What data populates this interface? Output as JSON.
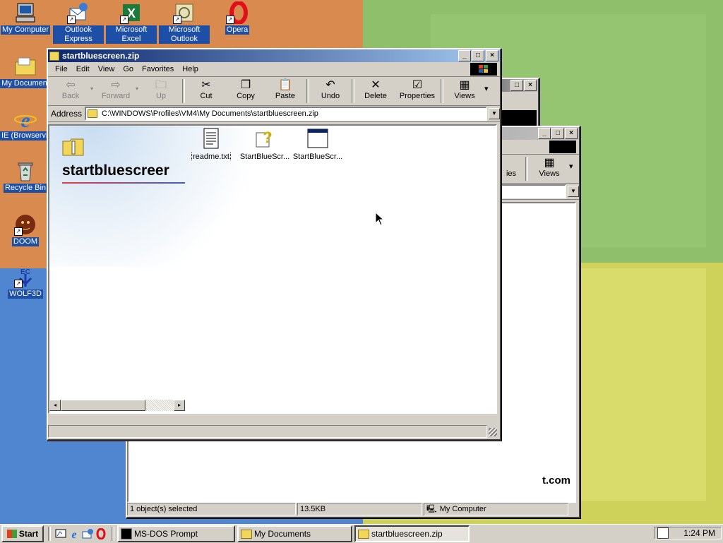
{
  "desktop": {
    "icons": [
      {
        "label": "My Computer",
        "icon": "my-computer-icon"
      },
      {
        "label": "Outlook Express",
        "icon": "outlook-express-icon"
      },
      {
        "label": "Microsoft Excel",
        "icon": "excel-icon"
      },
      {
        "label": "Microsoft Outlook",
        "icon": "outlook-icon"
      },
      {
        "label": "Opera",
        "icon": "opera-icon"
      },
      {
        "label": "My Document",
        "icon": "my-documents-icon"
      },
      {
        "label": "IE (Browservice",
        "icon": "ie-icon"
      },
      {
        "label": "Recycle Bin",
        "icon": "recycle-bin-icon"
      },
      {
        "label": "DOOM",
        "icon": "doom-icon"
      },
      {
        "label": "WOLF3D",
        "icon": "wolf3d-icon"
      }
    ],
    "partial_text": "t.com"
  },
  "front_window": {
    "title": "startbluescreen.zip",
    "menu": [
      "File",
      "Edit",
      "View",
      "Go",
      "Favorites",
      "Help"
    ],
    "toolbar": [
      {
        "label": "Back",
        "icon": "back-arrow-icon",
        "enabled": false
      },
      {
        "label": "Forward",
        "icon": "forward-arrow-icon",
        "enabled": false
      },
      {
        "label": "Up",
        "icon": "up-folder-icon",
        "enabled": false
      },
      {
        "label": "Cut",
        "icon": "scissors-icon",
        "enabled": true
      },
      {
        "label": "Copy",
        "icon": "copy-icon",
        "enabled": true
      },
      {
        "label": "Paste",
        "icon": "paste-icon",
        "enabled": true
      },
      {
        "label": "Undo",
        "icon": "undo-icon",
        "enabled": true
      },
      {
        "label": "Delete",
        "icon": "delete-x-icon",
        "enabled": true
      },
      {
        "label": "Properties",
        "icon": "properties-icon",
        "enabled": true
      },
      {
        "label": "Views",
        "icon": "views-icon",
        "enabled": true
      }
    ],
    "address_label": "Address",
    "address_value": "C:\\WINDOWS\\Profiles\\VM4\\My Documents\\startbluescreen.zip",
    "banner_title": "startbluescreer",
    "files": [
      {
        "name": "readme.txt",
        "icon": "text-file-icon",
        "selected": true
      },
      {
        "name": "StartBlueScr...",
        "icon": "help-file-icon",
        "selected": false
      },
      {
        "name": "StartBlueScr...",
        "icon": "application-icon",
        "selected": false
      }
    ]
  },
  "back_window": {
    "views_label": "Views",
    "partial_toolbar": "ies",
    "status": {
      "selection": "1 object(s) selected",
      "size": "13.5KB",
      "location": "My Computer"
    }
  },
  "taskbar": {
    "start_label": "Start",
    "tasks": [
      {
        "label": "MS-DOS Prompt",
        "icon": "msdos-icon",
        "active": false
      },
      {
        "label": "My Documents",
        "icon": "folder-icon",
        "active": false
      },
      {
        "label": "startbluescreen.zip",
        "icon": "zip-folder-icon",
        "active": true
      }
    ],
    "clock": "1:24 PM"
  }
}
